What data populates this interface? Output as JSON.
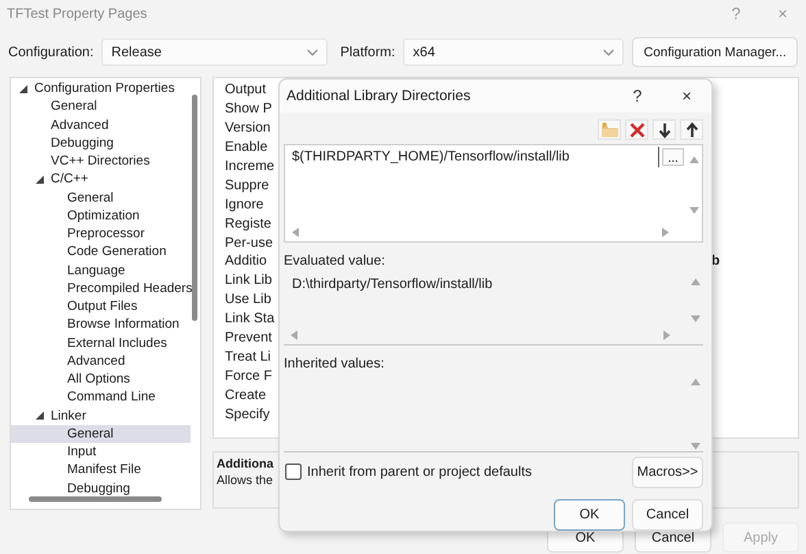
{
  "window": {
    "title": "TFTest Property Pages",
    "help": "?",
    "close": "×"
  },
  "configuration": {
    "label": "Configuration:",
    "value": "Release"
  },
  "platform": {
    "label": "Platform:",
    "value": "x64"
  },
  "config_manager_button": "Configuration Manager...",
  "tree": [
    {
      "label": "Configuration Properties",
      "expanded": true,
      "selected": false,
      "children": [
        {
          "label": "General",
          "selected": false
        },
        {
          "label": "Advanced",
          "selected": false
        },
        {
          "label": "Debugging",
          "selected": false
        },
        {
          "label": "VC++ Directories",
          "selected": false
        },
        {
          "label": "C/C++",
          "expanded": true,
          "selected": false,
          "children": [
            {
              "label": "General",
              "selected": false
            },
            {
              "label": "Optimization",
              "selected": false
            },
            {
              "label": "Preprocessor",
              "selected": false
            },
            {
              "label": "Code Generation",
              "selected": false
            },
            {
              "label": "Language",
              "selected": false
            },
            {
              "label": "Precompiled Headers",
              "selected": false
            },
            {
              "label": "Output Files",
              "selected": false
            },
            {
              "label": "Browse Information",
              "selected": false
            },
            {
              "label": "External Includes",
              "selected": false
            },
            {
              "label": "Advanced",
              "selected": false
            },
            {
              "label": "All Options",
              "selected": false
            },
            {
              "label": "Command Line",
              "selected": false
            }
          ]
        },
        {
          "label": "Linker",
          "expanded": true,
          "selected": false,
          "children": [
            {
              "label": "General",
              "selected": true
            },
            {
              "label": "Input",
              "selected": false
            },
            {
              "label": "Manifest File",
              "selected": false
            },
            {
              "label": "Debugging",
              "selected": false
            }
          ]
        }
      ]
    }
  ],
  "properties": [
    {
      "name": "Output"
    },
    {
      "name": "Show P"
    },
    {
      "name": "Version"
    },
    {
      "name": "Enable"
    },
    {
      "name": "Increme"
    },
    {
      "name": "Suppre"
    },
    {
      "name": "Ignore"
    },
    {
      "name": "Registe"
    },
    {
      "name": "Per-use"
    },
    {
      "name": "Additio",
      "value": "b"
    },
    {
      "name": "Link Lib"
    },
    {
      "name": "Use Lib"
    },
    {
      "name": "Link Sta"
    },
    {
      "name": "Prevent"
    },
    {
      "name": "Treat Li"
    },
    {
      "name": "Force F"
    },
    {
      "name": "Create"
    },
    {
      "name": "Specify"
    }
  ],
  "description": {
    "title": "Additiona",
    "text": "Allows the"
  },
  "buttons": [
    {
      "label": "OK",
      "disabled": false
    },
    {
      "label": "Cancel",
      "disabled": false
    },
    {
      "label": "Apply",
      "disabled": true
    }
  ],
  "dialog": {
    "title": "Additional Library Directories",
    "help": "?",
    "close": "×",
    "entries": [
      "$(THIRDPARTY_HOME)/Tensorflow/install/lib"
    ],
    "browse_button": "...",
    "evaluated_label": "Evaluated value:",
    "evaluated_value": "D:\\thirdparty/Tensorflow/install/lib",
    "inherited_label": "Inherited values:",
    "inherit_checkbox": {
      "label": "Inherit from parent or project defaults",
      "checked": false
    },
    "macros_button": "Macros>>",
    "ok_button": "OK",
    "cancel_button": "Cancel"
  }
}
